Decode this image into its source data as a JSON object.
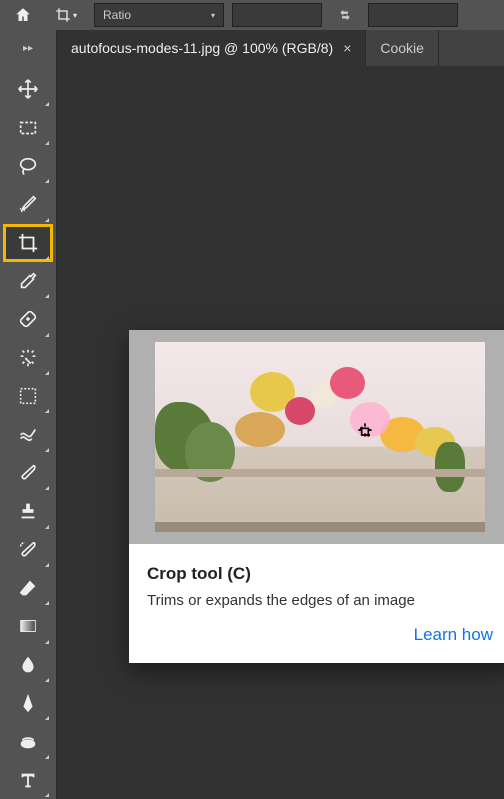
{
  "topbar": {
    "ratio_label": "Ratio"
  },
  "tabs": {
    "active": "autofocus-modes-11.jpg @ 100% (RGB/8)",
    "inactive": "Cookie"
  },
  "tools": [
    "move-tool",
    "marquee-tool",
    "lasso-tool",
    "brush-select-tool",
    "crop-tool",
    "eyedropper-tool",
    "heal-tool",
    "wand-tool",
    "frame-tool",
    "smudge-tool",
    "brush-tool",
    "stamp-tool",
    "history-brush-tool",
    "eraser-tool",
    "gradient-tool",
    "blur-tool",
    "pen-tool",
    "sponge-tool",
    "type-tool"
  ],
  "tooltip": {
    "title": "Crop tool (C)",
    "description": "Trims or expands the edges of an image",
    "link": "Learn how"
  }
}
